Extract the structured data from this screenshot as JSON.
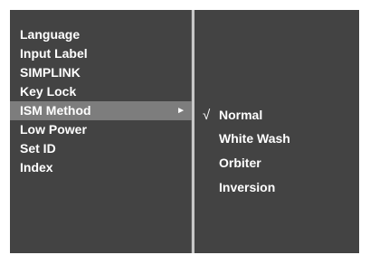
{
  "main_menu": {
    "items": [
      {
        "label": "Language"
      },
      {
        "label": "Input Label"
      },
      {
        "label": "SIMPLINK"
      },
      {
        "label": "Key Lock"
      },
      {
        "label": "ISM Method",
        "selected": true,
        "arrow": "►"
      },
      {
        "label": "Low Power"
      },
      {
        "label": "Set ID"
      },
      {
        "label": "Index"
      }
    ]
  },
  "submenu": {
    "check_mark": "√",
    "items": [
      {
        "label": "Normal",
        "checked": true
      },
      {
        "label": "White Wash"
      },
      {
        "label": "Orbiter"
      },
      {
        "label": "Inversion"
      }
    ]
  },
  "colors": {
    "panel_bg": "#434343",
    "highlight_bg": "#7d7d7d",
    "divider": "#c8c8c8",
    "text": "#ffffff"
  }
}
